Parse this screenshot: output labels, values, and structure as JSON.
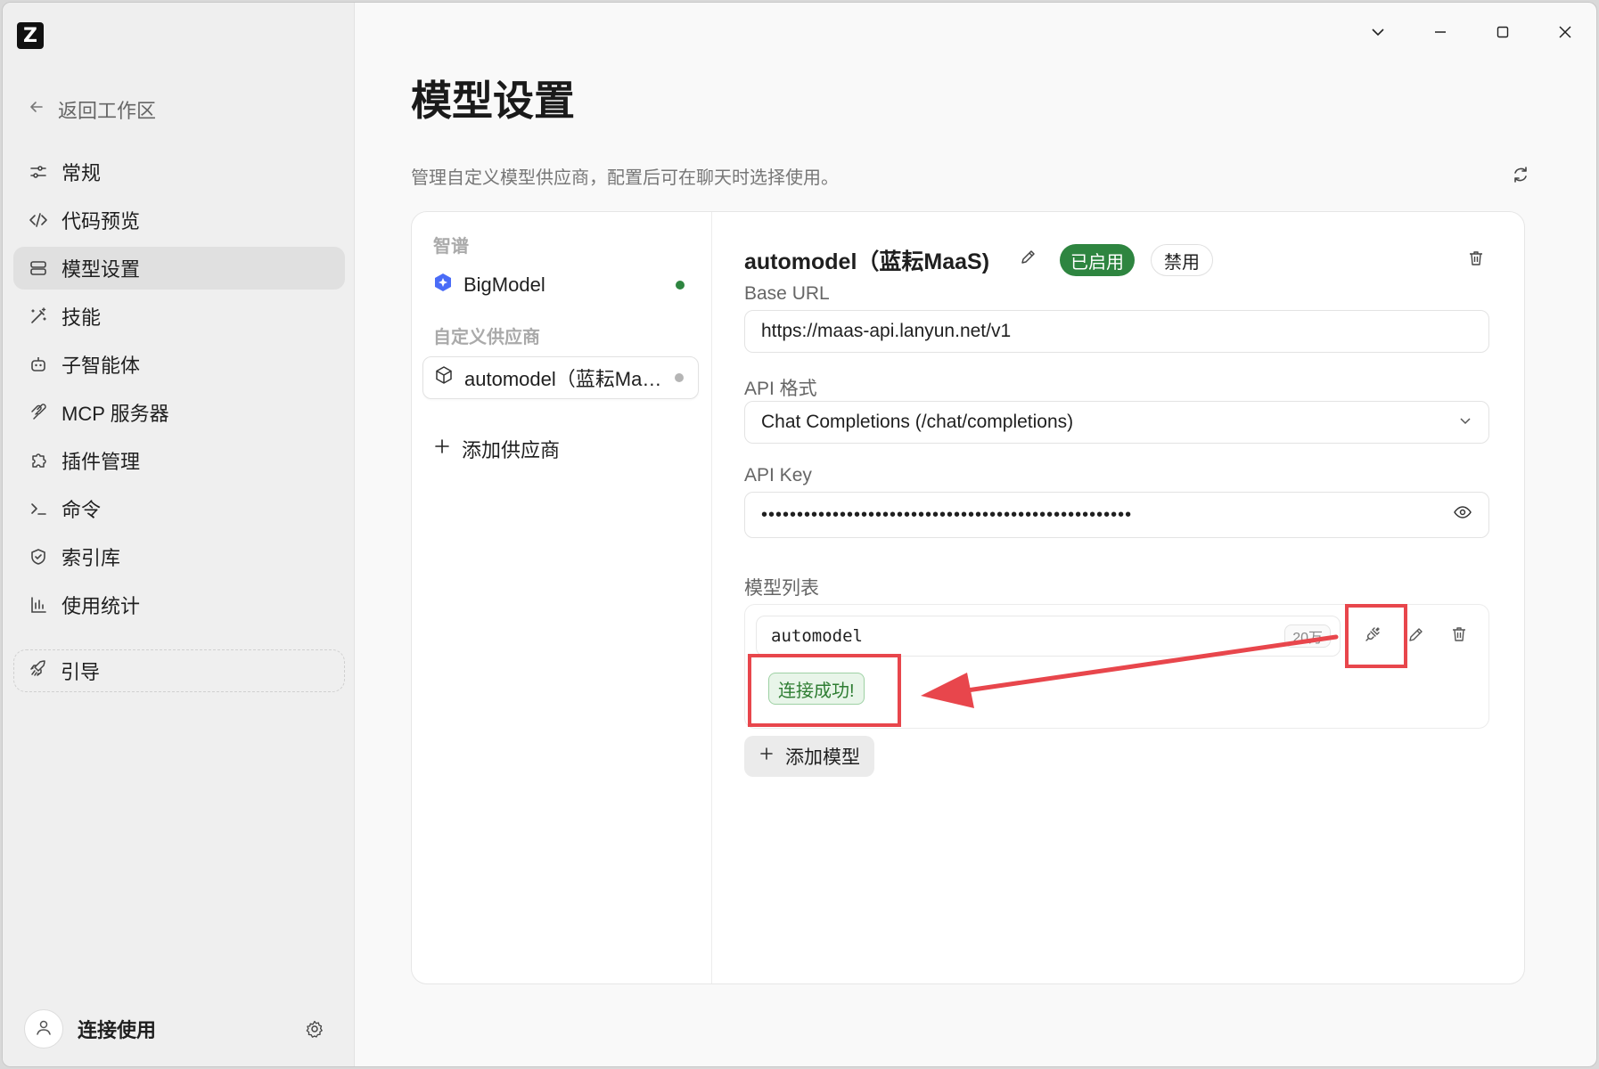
{
  "app": {
    "logo_letter": "Z"
  },
  "sidebar": {
    "back_label": "返回工作区",
    "items": [
      {
        "label": "常规",
        "icon": "sliders-icon"
      },
      {
        "label": "代码预览",
        "icon": "code-icon"
      },
      {
        "label": "模型设置",
        "icon": "server-icon",
        "active": true
      },
      {
        "label": "技能",
        "icon": "magic-wand-icon"
      },
      {
        "label": "子智能体",
        "icon": "bot-icon"
      },
      {
        "label": "MCP 服务器",
        "icon": "mcp-icon"
      },
      {
        "label": "插件管理",
        "icon": "puzzle-icon"
      },
      {
        "label": "命令",
        "icon": "terminal-icon"
      },
      {
        "label": "索引库",
        "icon": "shield-icon"
      },
      {
        "label": "使用统计",
        "icon": "bar-chart-icon"
      }
    ],
    "guide_label": "引导",
    "user_name": "连接使用"
  },
  "main": {
    "title": "模型设置",
    "description": "管理自定义模型供应商，配置后可在聊天时选择使用。"
  },
  "providers": {
    "group_builtin": "智谱",
    "builtin": {
      "name": "BigModel",
      "status_color": "#2e8540"
    },
    "group_custom": "自定义供应商",
    "custom": {
      "name": "automodel（蓝耘MaaS）",
      "status_color": "#b5b5b5"
    },
    "add_label": "添加供应商"
  },
  "detail": {
    "title": "automodel（蓝耘MaaS)",
    "enabled_badge": "已启用",
    "disable_button": "禁用",
    "base_url_label": "Base URL",
    "base_url_value": "https://maas-api.lanyun.net/v1",
    "api_format_label": "API 格式",
    "api_format_value": "Chat Completions (/chat/completions)",
    "api_key_label": "API Key",
    "api_key_masked": "••••••••••••••••••••••••••••••••••••••••••••••••••••",
    "models_label": "模型列表",
    "models": [
      {
        "name": "automodel",
        "context": "20万"
      }
    ],
    "connection_status": "连接成功!",
    "add_model_label": "添加模型"
  },
  "colors": {
    "accent_green": "#2e8540",
    "annotation_red": "#e8464c"
  }
}
